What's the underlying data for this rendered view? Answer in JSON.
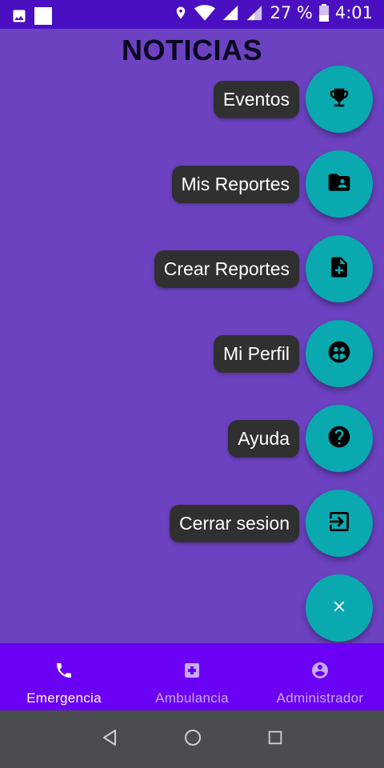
{
  "status_bar": {
    "battery": "27 %",
    "time": "4:01"
  },
  "page": {
    "title": "NOTICIAS"
  },
  "menu": {
    "items": [
      {
        "label": "Eventos",
        "icon": "trophy-icon"
      },
      {
        "label": "Mis Reportes",
        "icon": "folder-shared-icon"
      },
      {
        "label": "Crear Reportes",
        "icon": "note-add-icon"
      },
      {
        "label": "Mi Perfil",
        "icon": "face-icon"
      },
      {
        "label": "Ayuda",
        "icon": "help-icon"
      },
      {
        "label": "Cerrar sesion",
        "icon": "logout-icon"
      }
    ],
    "close_icon": "close-icon"
  },
  "bottom_nav": {
    "items": [
      {
        "label": "Emergencia",
        "icon": "phone-icon",
        "active": true
      },
      {
        "label": "Ambulancia",
        "icon": "medical-plus-icon",
        "active": false
      },
      {
        "label": "Administrador",
        "icon": "account-circle-icon",
        "active": false
      }
    ]
  },
  "colors": {
    "background": "#6c42c1",
    "status_bar": "#4a0fc0",
    "fab": "#0aa9b0",
    "label_bg": "#303030",
    "bottom_nav": "#6a00f4",
    "system_nav": "#4a4c50"
  }
}
